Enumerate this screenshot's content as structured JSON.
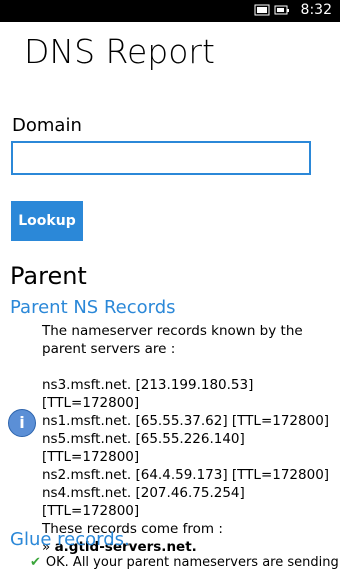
{
  "status": {
    "time": "8:32"
  },
  "page": {
    "title": "DNS Report"
  },
  "form": {
    "domain_label": "Domain",
    "domain_value": "",
    "lookup_label": "Lookup"
  },
  "parent": {
    "title": "Parent",
    "ns_title": "Parent NS Records",
    "intro": "The nameserver records known by the parent servers are :",
    "records": [
      "ns3.msft.net. [213.199.180.53] [TTL=172800]",
      "ns1.msft.net. [65.55.37.62] [TTL=172800]",
      "ns5.msft.net. [65.55.226.140] [TTL=172800]",
      "ns2.msft.net. [64.4.59.173] [TTL=172800]",
      "ns4.msft.net. [207.46.75.254] [TTL=172800]"
    ],
    "from_text": "These records come from :",
    "from_prefix": "»",
    "from_server": "a.gtld-servers.net.",
    "glue_title": "Glue records.",
    "glue_text": "OK. All your parent nameservers are sending"
  }
}
